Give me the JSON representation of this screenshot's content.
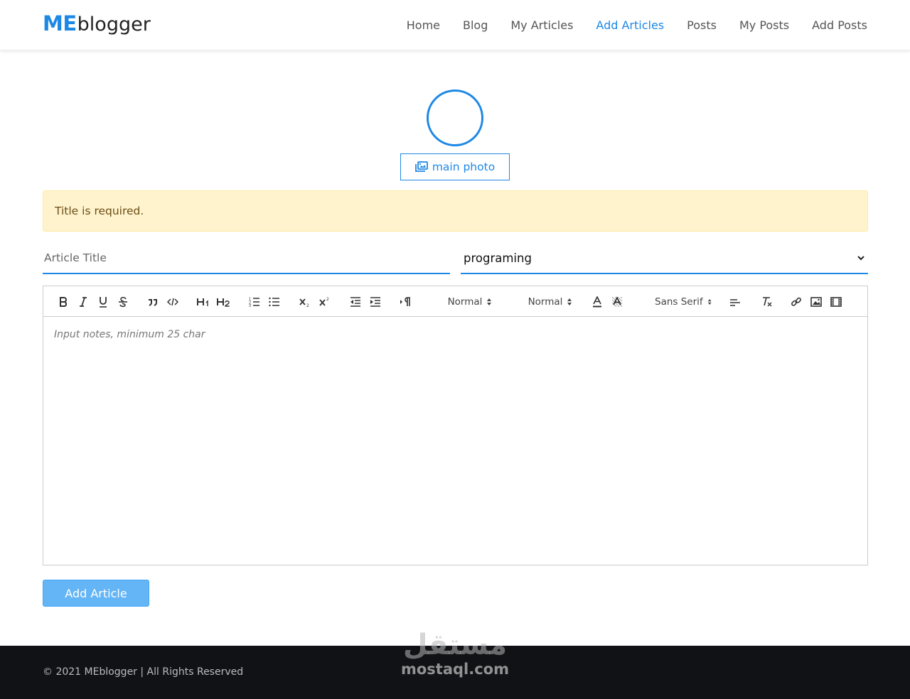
{
  "brand": {
    "prefix": "ME",
    "suffix": "blogger"
  },
  "nav": {
    "items": [
      {
        "label": "Home",
        "active": false
      },
      {
        "label": "Blog",
        "active": false
      },
      {
        "label": "My Articles",
        "active": false
      },
      {
        "label": "Add Articles",
        "active": true
      },
      {
        "label": "Posts",
        "active": false
      },
      {
        "label": "My Posts",
        "active": false
      },
      {
        "label": "Add Posts",
        "active": false
      }
    ]
  },
  "photo": {
    "button_label": "main photo",
    "icon": "images-icon"
  },
  "alert": {
    "message": "Title is required."
  },
  "form": {
    "title_placeholder": "Article Title",
    "title_value": "",
    "category_selected": "programing",
    "editor_placeholder": "Input notes, minimum 25 char",
    "submit_label": "Add Article"
  },
  "toolbar": {
    "header_select": "Normal",
    "size_select": "Normal",
    "font_select": "Sans Serif",
    "icons": [
      "bold-icon",
      "italic-icon",
      "underline-icon",
      "strike-icon",
      "blockquote-icon",
      "code-block-icon",
      "header-1-icon",
      "header-2-icon",
      "ordered-list-icon",
      "bullet-list-icon",
      "subscript-icon",
      "superscript-icon",
      "outdent-icon",
      "indent-icon",
      "direction-rtl-icon",
      "text-color-icon",
      "background-color-icon",
      "align-icon",
      "clean-format-icon",
      "link-icon",
      "image-icon",
      "video-icon"
    ]
  },
  "footer": {
    "copyright": "© 2021 MEblogger | All Rights Reserved",
    "watermark_arabic": "مستقل",
    "watermark_latin": "mostaql.com"
  },
  "colors": {
    "accent": "#1e88e5",
    "alert_bg": "#fff3cd",
    "alert_text": "#6b4e16",
    "submit_bg": "#64b5f6",
    "footer_bg": "#111216"
  }
}
